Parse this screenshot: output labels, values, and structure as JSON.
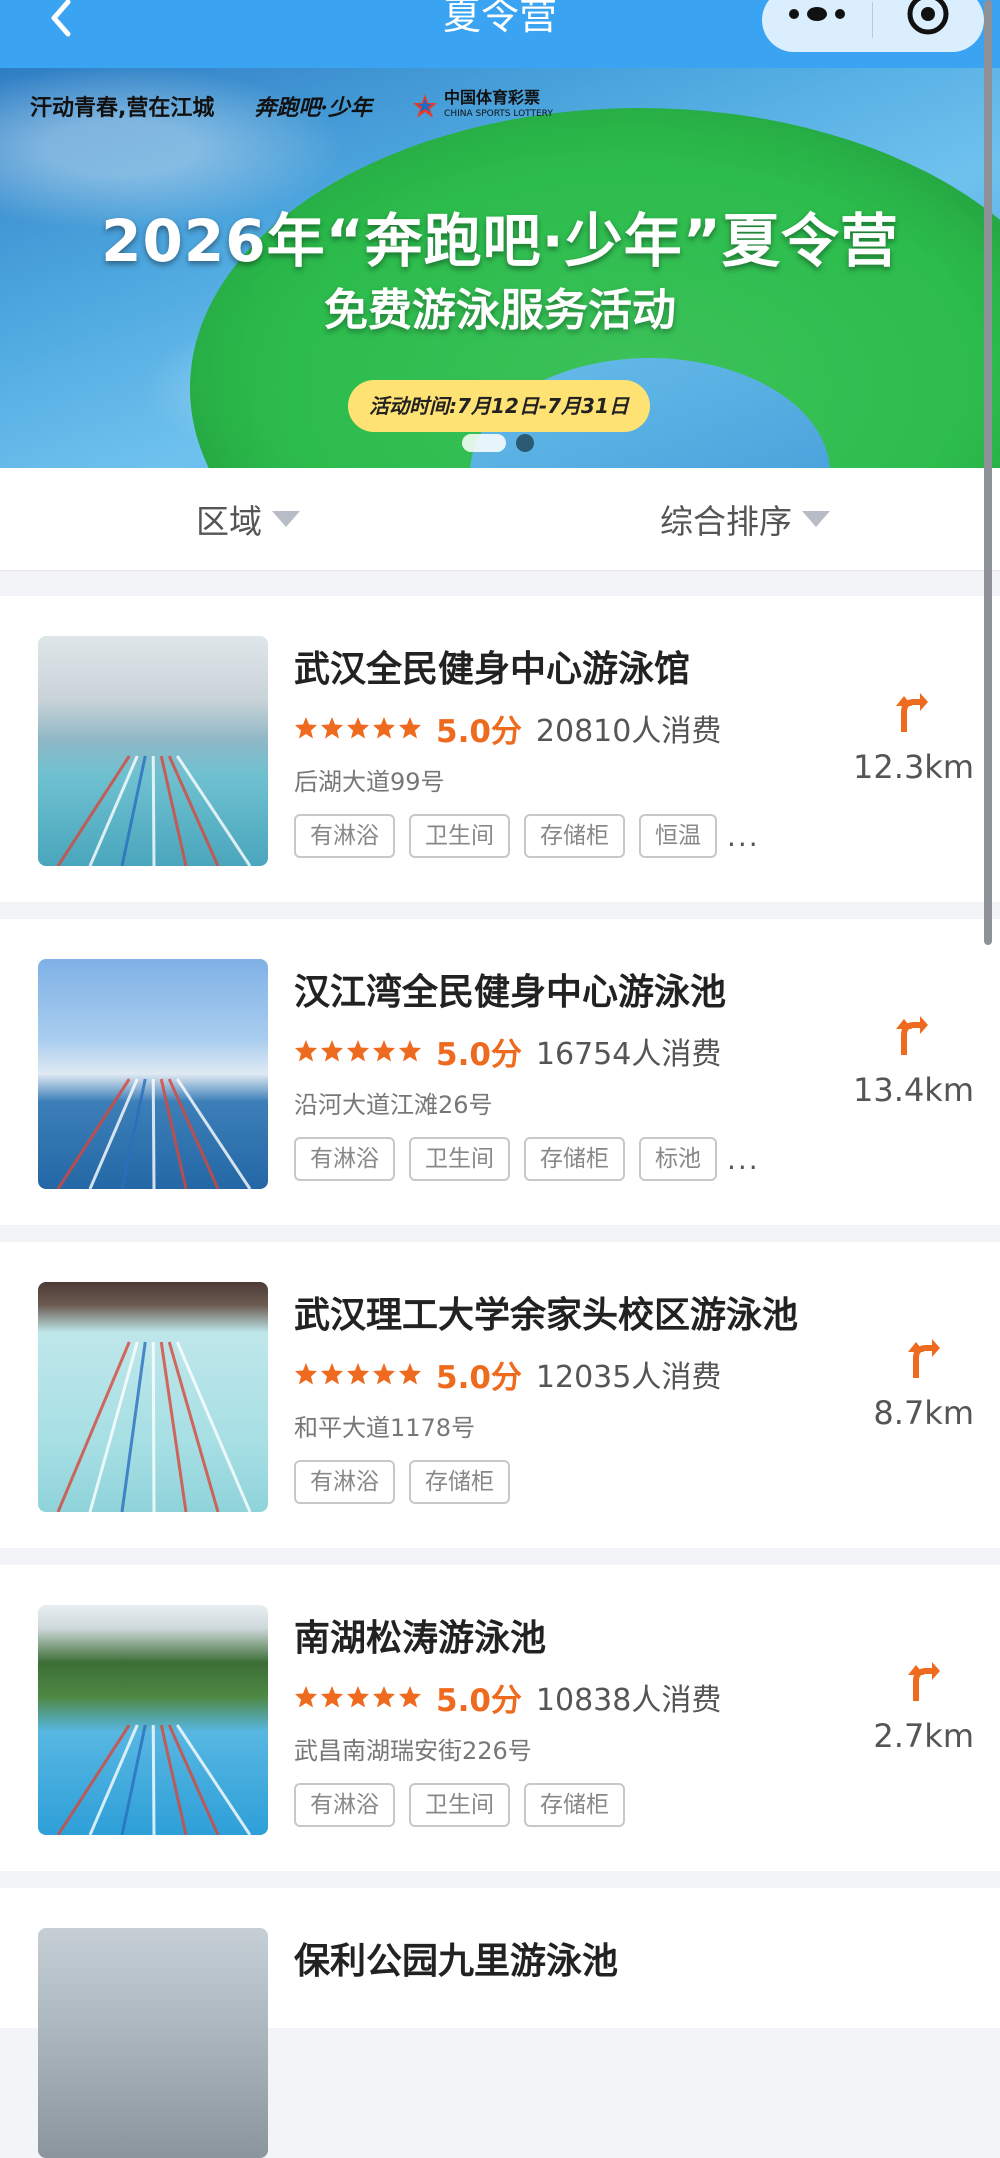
{
  "header": {
    "title": "夏令营",
    "back_icon": "chevron-left-icon",
    "more_icon": "more-dots-icon",
    "close_icon": "target-close-icon"
  },
  "banner": {
    "logo_1": "汗动青春,营在江城",
    "logo_2": "奔跑吧·少年",
    "logo_3": "中国体育彩票",
    "logo_3_en": "CHINA SPORTS LOTTERY",
    "title": "2026年“奔跑吧·少年”夏令营",
    "subtitle": "免费游泳服务活动",
    "event_time": "活动时间:7月12日-7月31日",
    "slide_count": 2,
    "active_slide": 1
  },
  "filters": {
    "area": "区域",
    "sort": "综合排序"
  },
  "colors": {
    "accent": "#ee6a1f",
    "header": "#3aa3f2",
    "tag_border": "#c8c8cc"
  },
  "venues": [
    {
      "name": "武汉全民健身中心游泳馆",
      "score": "5.0分",
      "sold": "20810人消费",
      "address": "后湖大道99号",
      "tags": [
        "有淋浴",
        "卫生间",
        "存储柜",
        "恒温"
      ],
      "more": "...",
      "distance": "12.3km"
    },
    {
      "name": "汉江湾全民健身中心游泳池",
      "score": "5.0分",
      "sold": "16754人消费",
      "address": "沿河大道江滩26号",
      "tags": [
        "有淋浴",
        "卫生间",
        "存储柜",
        "标池"
      ],
      "more": "...",
      "distance": "13.4km"
    },
    {
      "name": "武汉理工大学余家头校区游泳池",
      "score": "5.0分",
      "sold": "12035人消费",
      "address": "和平大道1178号",
      "tags": [
        "有淋浴",
        "存储柜"
      ],
      "more": "",
      "distance": "8.7km"
    },
    {
      "name": "南湖松涛游泳池",
      "score": "5.0分",
      "sold": "10838人消费",
      "address": "武昌南湖瑞安街226号",
      "tags": [
        "有淋浴",
        "卫生间",
        "存储柜"
      ],
      "more": "",
      "distance": "2.7km"
    },
    {
      "name": "保利公园九里游泳池",
      "score": "",
      "sold": "",
      "address": "",
      "tags": [],
      "more": "",
      "distance": ""
    }
  ]
}
